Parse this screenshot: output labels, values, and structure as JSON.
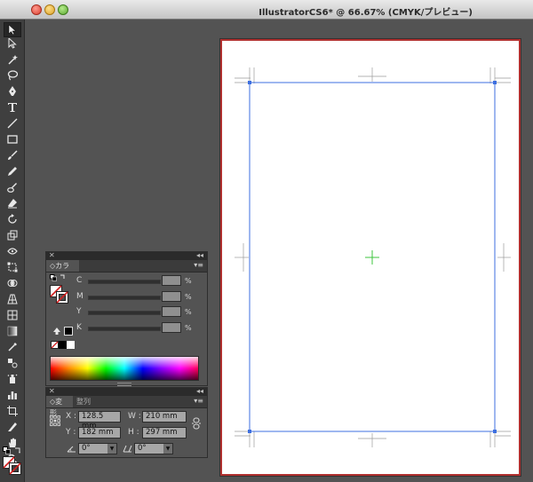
{
  "window": {
    "title": "IllustratorCS6* @ 66.67% (CMYK/プレビュー)"
  },
  "tools": [
    {
      "name": "selection-tool",
      "icon": "arrow-black"
    },
    {
      "name": "direct-selection-tool",
      "icon": "arrow-white"
    },
    {
      "name": "magic-wand-tool",
      "icon": "wand"
    },
    {
      "name": "lasso-tool",
      "icon": "lasso"
    },
    {
      "name": "pen-tool",
      "icon": "pen"
    },
    {
      "name": "type-tool",
      "icon": "T"
    },
    {
      "name": "line-tool",
      "icon": "line"
    },
    {
      "name": "rectangle-tool",
      "icon": "rect"
    },
    {
      "name": "paintbrush-tool",
      "icon": "brush"
    },
    {
      "name": "pencil-tool",
      "icon": "pencil"
    },
    {
      "name": "blob-brush-tool",
      "icon": "blob"
    },
    {
      "name": "eraser-tool",
      "icon": "eraser"
    },
    {
      "name": "rotate-tool",
      "icon": "rotate"
    },
    {
      "name": "scale-tool",
      "icon": "scale"
    },
    {
      "name": "width-tool",
      "icon": "width"
    },
    {
      "name": "free-transform-tool",
      "icon": "free-transform"
    },
    {
      "name": "shape-builder-tool",
      "icon": "shape-builder"
    },
    {
      "name": "perspective-grid-tool",
      "icon": "perspective"
    },
    {
      "name": "mesh-tool",
      "icon": "mesh"
    },
    {
      "name": "gradient-tool",
      "icon": "gradient"
    },
    {
      "name": "eyedropper-tool",
      "icon": "eyedropper"
    },
    {
      "name": "blend-tool",
      "icon": "blend"
    },
    {
      "name": "symbol-sprayer-tool",
      "icon": "symbol"
    },
    {
      "name": "column-graph-tool",
      "icon": "graph"
    },
    {
      "name": "artboard-tool",
      "icon": "artboard"
    },
    {
      "name": "slice-tool",
      "icon": "slice"
    },
    {
      "name": "hand-tool",
      "icon": "hand"
    },
    {
      "name": "zoom-tool",
      "icon": "zoom"
    }
  ],
  "color_panel": {
    "tab_label": "カラー",
    "channels": [
      {
        "label": "C",
        "unit": "%"
      },
      {
        "label": "M",
        "unit": "%"
      },
      {
        "label": "Y",
        "unit": "%"
      },
      {
        "label": "K",
        "unit": "%"
      }
    ]
  },
  "transform_panel": {
    "tabs": [
      "変形",
      "整列"
    ],
    "x_label": "X :",
    "x_value": "128.5 mm",
    "y_label": "Y :",
    "y_value": "182 mm",
    "w_label": "W :",
    "w_value": "210 mm",
    "h_label": "H :",
    "h_value": "297 mm",
    "rotate_value": "0°",
    "shear_value": "0°"
  },
  "colors": {
    "artboard_border": "#b0302f",
    "guide_blue": "#3d6fe0",
    "center_mark": "#3ec43e"
  }
}
